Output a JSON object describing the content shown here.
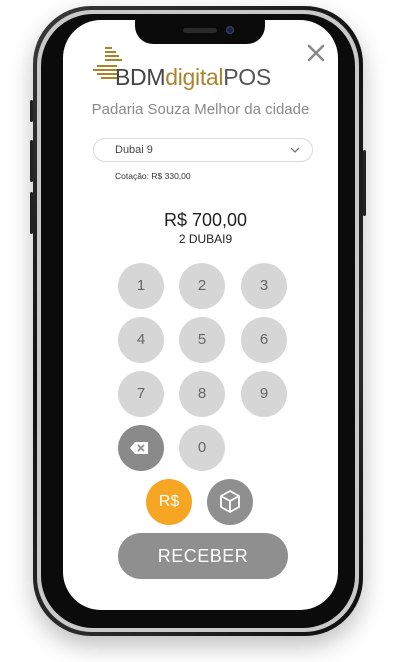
{
  "brand": {
    "part1": "BDM",
    "part2": "digital",
    "part3": "POS"
  },
  "store": {
    "name": "Padaria Souza Melhor da cidade"
  },
  "currency_select": {
    "value": "Dubai 9"
  },
  "rate": {
    "text": "Cotação: R$ 330,00"
  },
  "amount": {
    "fiat": "R$ 700,00",
    "crypto": "2 DUBAI9"
  },
  "keypad": {
    "keys": [
      "1",
      "2",
      "3",
      "4",
      "5",
      "6",
      "7",
      "8",
      "9",
      "0"
    ]
  },
  "mode_buttons": {
    "fiat_label": "R$"
  },
  "actions": {
    "receive_label": "RECEBER"
  },
  "icons": {
    "close": "close-icon",
    "backspace": "backspace-icon",
    "cube": "cube-icon",
    "chevron": "chevron-down-icon"
  },
  "colors": {
    "accent_orange": "#f6a623",
    "brand_gold": "#a8842f",
    "key_gray": "#d6d6d6",
    "button_gray": "#8f8f8f"
  }
}
